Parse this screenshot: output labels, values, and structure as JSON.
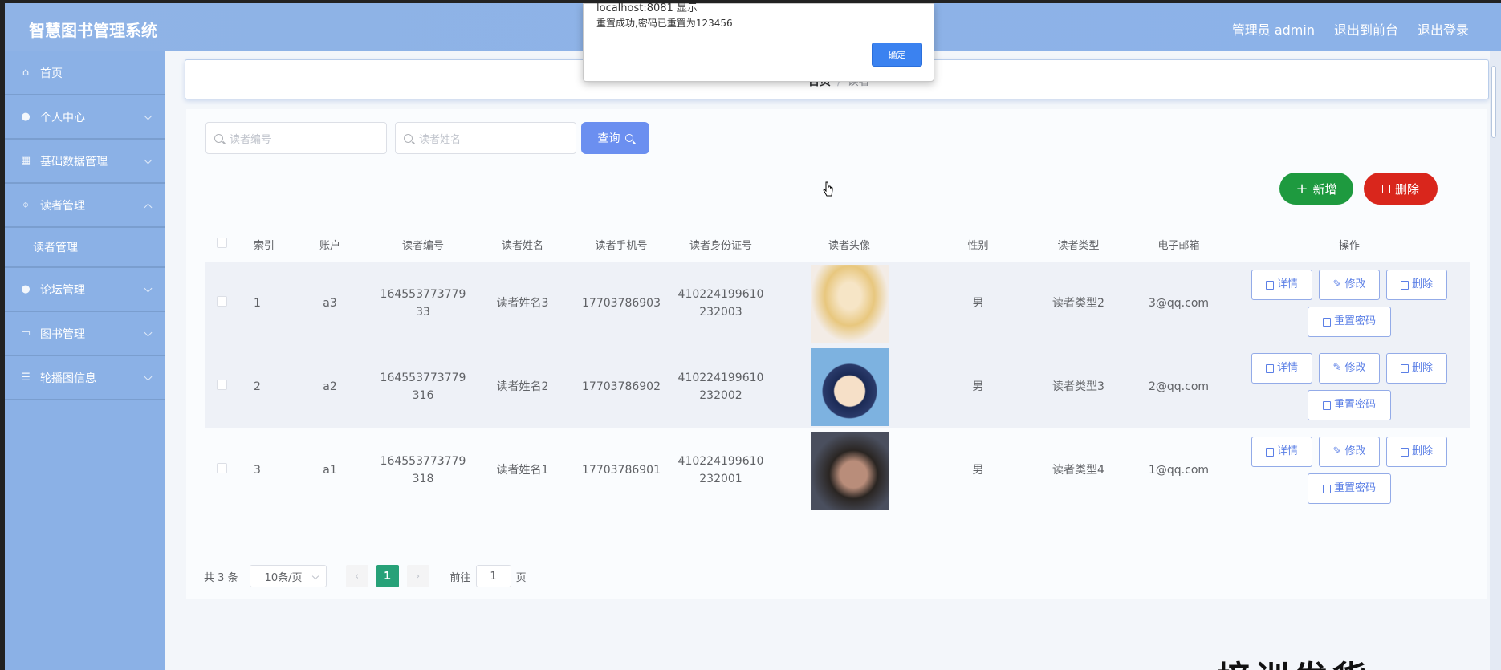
{
  "app": {
    "title": "智慧图书管理系统"
  },
  "topbar": {
    "admin": "管理员 admin",
    "front": "退出到前台",
    "logout": "退出登录"
  },
  "sidebar": {
    "items": [
      {
        "label": "首页",
        "icon": "home-icon"
      },
      {
        "label": "个人中心",
        "icon": "user-icon"
      },
      {
        "label": "基础数据管理",
        "icon": "table-icon"
      },
      {
        "label": "读者管理",
        "icon": "pin-icon"
      },
      {
        "label": "读者管理",
        "icon": "",
        "sub": true
      },
      {
        "label": "论坛管理",
        "icon": "user-icon"
      },
      {
        "label": "图书管理",
        "icon": "chat-icon"
      },
      {
        "label": "轮播图信息",
        "icon": "list-icon"
      }
    ]
  },
  "breadcrumb": {
    "home": "首页",
    "sep": "/",
    "current": "读者"
  },
  "search": {
    "reader_no_placeholder": "读者编号",
    "reader_name_placeholder": "读者姓名",
    "query_label": "查询"
  },
  "actions": {
    "add_label": "新增",
    "delete_label": "删除"
  },
  "table": {
    "headers": [
      "",
      "索引",
      "账户",
      "读者编号",
      "读者姓名",
      "读者手机号",
      "读者身份证号",
      "读者头像",
      "性别",
      "读者类型",
      "电子邮箱",
      "操作"
    ],
    "rows": [
      {
        "index": "1",
        "account": "a3",
        "reader_no_1": "164553773779",
        "reader_no_2": "33",
        "name": "读者姓名3",
        "phone": "17703786903",
        "id_1": "410224199610",
        "id_2": "232003",
        "gender": "男",
        "type": "读者类型2",
        "email": "3@qq.com"
      },
      {
        "index": "2",
        "account": "a2",
        "reader_no_1": "164553773779",
        "reader_no_2": "316",
        "name": "读者姓名2",
        "phone": "17703786902",
        "id_1": "410224199610",
        "id_2": "232002",
        "gender": "男",
        "type": "读者类型3",
        "email": "2@qq.com"
      },
      {
        "index": "3",
        "account": "a1",
        "reader_no_1": "164553773779",
        "reader_no_2": "318",
        "name": "读者姓名1",
        "phone": "17703786901",
        "id_1": "410224199610",
        "id_2": "232001",
        "gender": "男",
        "type": "读者类型4",
        "email": "1@qq.com"
      }
    ],
    "ops": {
      "detail": "详情",
      "edit": "修改",
      "delete": "删除",
      "reset": "重置密码"
    }
  },
  "pagination": {
    "total": "共 3 条",
    "page_size": "10条/页",
    "current": "1",
    "goto": "前往",
    "goto_value": "1",
    "page_unit": "页"
  },
  "dialog": {
    "title": "localhost:8081 显示",
    "message": "重置成功,密码已重置为123456",
    "ok": "确定"
  },
  "watermark": "培训发货",
  "colors": {
    "header": "#8fb3e6",
    "add": "#1e9a3f",
    "delete": "#d9261c",
    "query": "#6b8ff0",
    "page_current": "#27a178"
  }
}
